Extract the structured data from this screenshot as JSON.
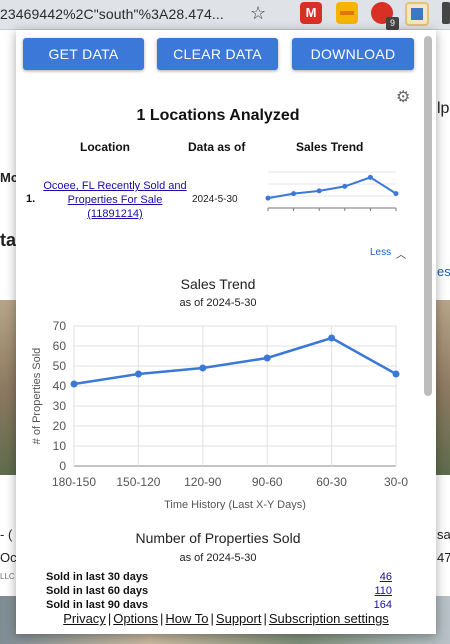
{
  "browser": {
    "url_fragment": "23469442%2C\"south\"%3A28.474...",
    "extension_badge": "9",
    "ext1_label": "M"
  },
  "background_page": {
    "fragments": [
      "lp",
      "Mc",
      "ta",
      "es",
      "- (",
      "Oc",
      "LLC",
      "sa",
      "47"
    ]
  },
  "toolbar": {
    "get_data_label": "GET DATA",
    "clear_data_label": "CLEAR DATA",
    "download_label": "DOWNLOAD"
  },
  "summary": {
    "heading": "1 Locations Analyzed",
    "columns": [
      "Location",
      "Data as of",
      "Sales Trend"
    ],
    "rows": [
      {
        "index": "1.",
        "location": "Ocoee, FL Recently Sold and Properties For Sale (11891214)",
        "date": "2024-5-30"
      }
    ],
    "toggle_label": "Less"
  },
  "chart_data": {
    "type": "line",
    "title": "Sales Trend",
    "subtitle": "as of 2024-5-30",
    "xlabel": "Time History (Last X-Y Days)",
    "ylabel": "# of Properties Sold",
    "categories": [
      "180-150",
      "150-120",
      "120-90",
      "90-60",
      "60-30",
      "30-0"
    ],
    "values": [
      41,
      46,
      49,
      54,
      64,
      46
    ],
    "ylim": [
      0,
      70
    ],
    "yticks": [
      0,
      10,
      20,
      30,
      40,
      50,
      60,
      70
    ],
    "grid": true,
    "color": "#3b78d8"
  },
  "sold_section": {
    "title": "Number of Properties Sold",
    "subtitle": "as of 2024-5-30",
    "rows": [
      {
        "label": "Sold in last 30 days",
        "value": "46"
      },
      {
        "label": "Sold in last 60 days",
        "value": "110"
      },
      {
        "label": "Sold in last 90 days",
        "value": "164"
      }
    ]
  },
  "footer": {
    "links": [
      "Privacy",
      "Options",
      "How To",
      "Support",
      "Subscription settings"
    ]
  }
}
